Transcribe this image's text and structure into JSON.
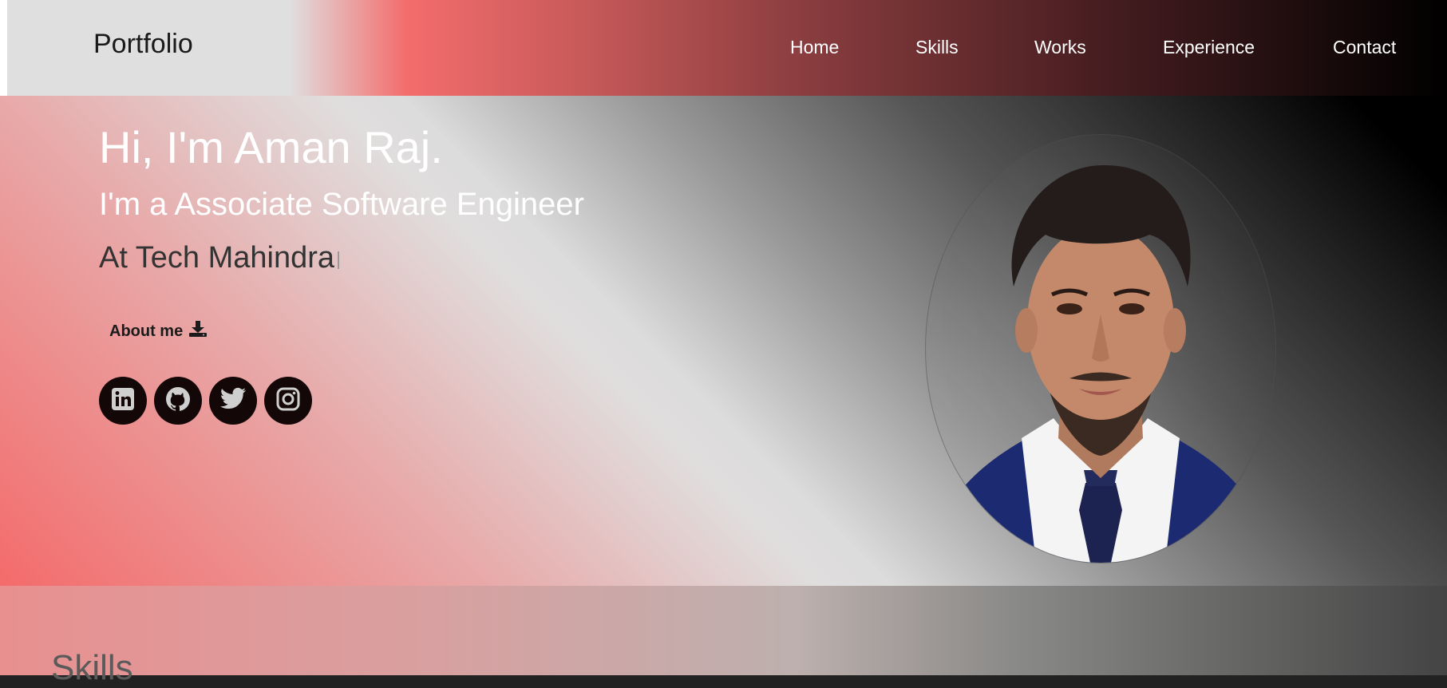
{
  "nav": {
    "brand": "Portfolio",
    "links": [
      "Home",
      "Skills",
      "Works",
      "Experience",
      "Contact"
    ]
  },
  "hero": {
    "greeting": "Hi, I'm Aman Raj.",
    "role": "I'm a Associate Software Engineer",
    "company": "At Tech Mahindra",
    "about_label": "About me",
    "about_icon": "download-icon",
    "socials": [
      "linkedin-icon",
      "github-icon",
      "twitter-icon",
      "instagram-icon"
    ]
  },
  "profile_photo": "profile-photo",
  "skills": {
    "title": "Skills"
  },
  "colors": {
    "accent": "#f46d6d",
    "dark": "#140707",
    "white": "#ffffff"
  }
}
